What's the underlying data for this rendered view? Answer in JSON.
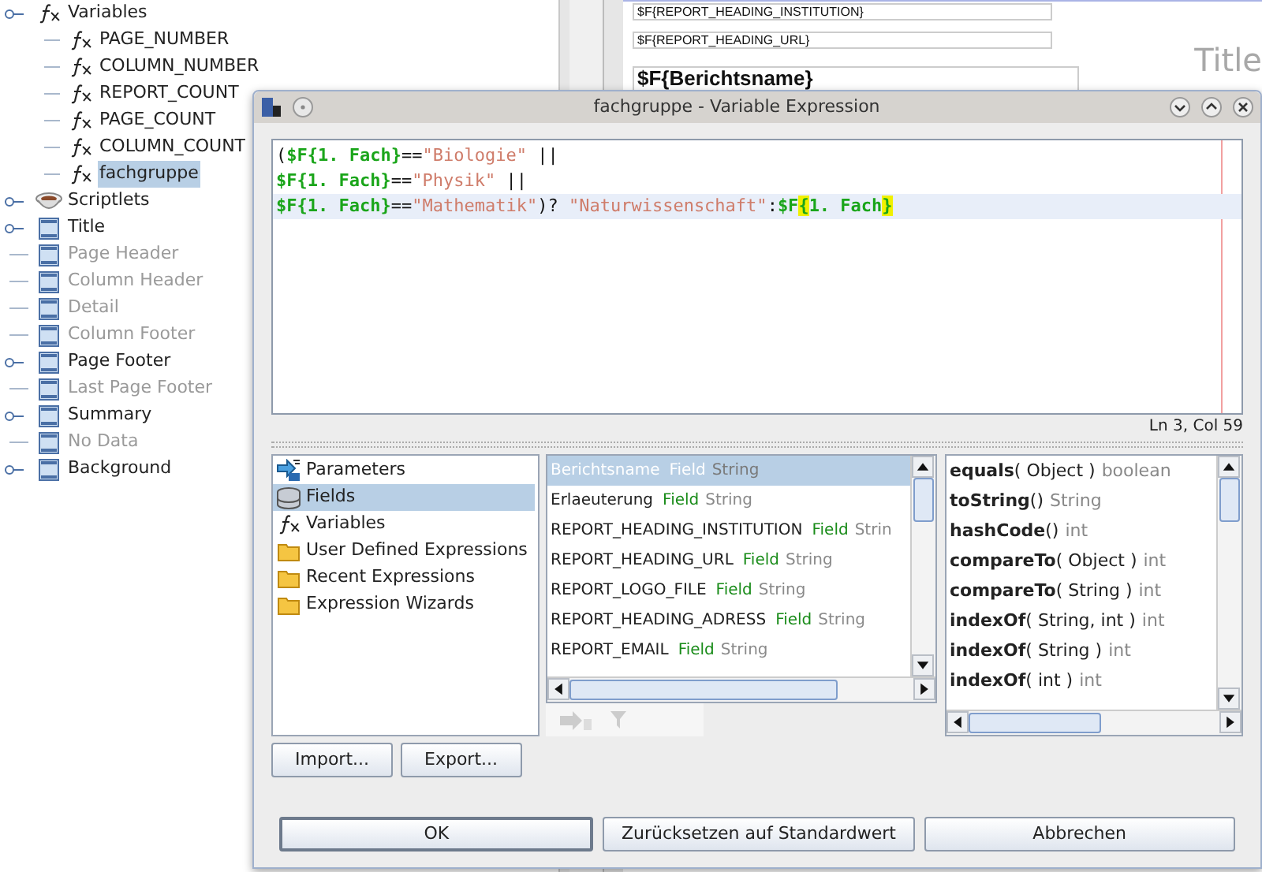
{
  "tree": [
    {
      "label": "Variables",
      "kind": "fx",
      "disabled": false,
      "selected": false,
      "expander": true,
      "children": [
        {
          "label": "PAGE_NUMBER",
          "kind": "fx",
          "disabled": false,
          "selected": false
        },
        {
          "label": "COLUMN_NUMBER",
          "kind": "fx",
          "disabled": false,
          "selected": false
        },
        {
          "label": "REPORT_COUNT",
          "kind": "fx",
          "disabled": false,
          "selected": false
        },
        {
          "label": "PAGE_COUNT",
          "kind": "fx",
          "disabled": false,
          "selected": false
        },
        {
          "label": "COLUMN_COUNT",
          "kind": "fx",
          "disabled": false,
          "selected": false
        },
        {
          "label": "fachgruppe",
          "kind": "fx",
          "disabled": false,
          "selected": true
        }
      ]
    },
    {
      "label": "Scriptlets",
      "kind": "cup",
      "disabled": false,
      "selected": false,
      "expander": true
    },
    {
      "label": "Title",
      "kind": "band",
      "disabled": false,
      "selected": false,
      "expander": true
    },
    {
      "label": "Page Header",
      "kind": "band",
      "disabled": true,
      "selected": false,
      "expander": false
    },
    {
      "label": "Column Header",
      "kind": "band",
      "disabled": true,
      "selected": false,
      "expander": false
    },
    {
      "label": "Detail",
      "kind": "band",
      "disabled": true,
      "selected": false,
      "expander": false
    },
    {
      "label": "Column Footer",
      "kind": "band",
      "disabled": true,
      "selected": false,
      "expander": false
    },
    {
      "label": "Page Footer",
      "kind": "band",
      "disabled": false,
      "selected": false,
      "expander": true
    },
    {
      "label": "Last Page Footer",
      "kind": "band",
      "disabled": true,
      "selected": false,
      "expander": false
    },
    {
      "label": "Summary",
      "kind": "band",
      "disabled": false,
      "selected": false,
      "expander": true
    },
    {
      "label": "No Data",
      "kind": "band",
      "disabled": true,
      "selected": false,
      "expander": false
    },
    {
      "label": "Background",
      "kind": "band",
      "disabled": false,
      "selected": false,
      "expander": true
    }
  ],
  "canvas": {
    "fields": [
      {
        "text": "$F{REPORT_HEADING_INSTITUTION}",
        "kind": "small"
      },
      {
        "text": "$F{REPORT_HEADING_URL}",
        "kind": "small"
      },
      {
        "text": "$F{Berichtsname}",
        "kind": "large"
      }
    ],
    "band_label": "Title"
  },
  "dialog": {
    "title": "fachgruppe - Variable Expression",
    "code": [
      {
        "current": false,
        "tokens": [
          {
            "kind": "plain",
            "text": "("
          },
          {
            "kind": "field",
            "text": "$F{1. Fach}"
          },
          {
            "kind": "plain",
            "text": "=="
          },
          {
            "kind": "string",
            "text": "\"Biologie\""
          },
          {
            "kind": "plain",
            "text": " ||"
          }
        ]
      },
      {
        "current": false,
        "tokens": [
          {
            "kind": "field",
            "text": "$F{1. Fach}"
          },
          {
            "kind": "plain",
            "text": "=="
          },
          {
            "kind": "string",
            "text": "\"Physik\""
          },
          {
            "kind": "plain",
            "text": " ||"
          }
        ]
      },
      {
        "current": true,
        "tokens": [
          {
            "kind": "field",
            "text": "$F{1. Fach}"
          },
          {
            "kind": "plain",
            "text": "=="
          },
          {
            "kind": "string",
            "text": "\"Mathematik\""
          },
          {
            "kind": "plain",
            "text": ")? "
          },
          {
            "kind": "string",
            "text": "\"Naturwissenschaft\""
          },
          {
            "kind": "plain",
            "text": ":"
          },
          {
            "kind": "field",
            "text": "$F"
          },
          {
            "kind": "match",
            "text": "{"
          },
          {
            "kind": "field",
            "text": "1. Fach"
          },
          {
            "kind": "match",
            "text": "}"
          }
        ]
      }
    ],
    "caret_position": "Ln 3, Col 59",
    "categories": [
      {
        "label": "Parameters",
        "kind": "parameters",
        "selected": false
      },
      {
        "label": "Fields",
        "kind": "fields",
        "selected": true
      },
      {
        "label": "Variables",
        "kind": "fx",
        "selected": false
      },
      {
        "label": "User Defined Expressions",
        "kind": "folder",
        "selected": false
      },
      {
        "label": "Recent Expressions",
        "kind": "folder",
        "selected": false
      },
      {
        "label": "Expression Wizards",
        "kind": "folder",
        "selected": false
      }
    ],
    "fields": [
      {
        "name": "Berichtsname",
        "kind_label": "Field",
        "type": "String",
        "selected": true
      },
      {
        "name": "Erlaeuterung",
        "kind_label": "Field",
        "type": "String",
        "selected": false
      },
      {
        "name": "REPORT_HEADING_INSTITUTION",
        "kind_label": "Field",
        "type": "Strin",
        "selected": false
      },
      {
        "name": "REPORT_HEADING_URL",
        "kind_label": "Field",
        "type": "String",
        "selected": false
      },
      {
        "name": "REPORT_LOGO_FILE",
        "kind_label": "Field",
        "type": "String",
        "selected": false
      },
      {
        "name": "REPORT_HEADING_ADRESS",
        "kind_label": "Field",
        "type": "String",
        "selected": false
      },
      {
        "name": "REPORT_EMAIL",
        "kind_label": "Field",
        "type": "String",
        "selected": false
      }
    ],
    "methods": [
      {
        "name": "equals",
        "params": "( Object )",
        "returns": "boolean"
      },
      {
        "name": "toString",
        "params": "()",
        "returns": "String"
      },
      {
        "name": "hashCode",
        "params": "()",
        "returns": "int"
      },
      {
        "name": "compareTo",
        "params": "( Object )",
        "returns": "int"
      },
      {
        "name": "compareTo",
        "params": "( String )",
        "returns": "int"
      },
      {
        "name": "indexOf",
        "params": "( String, int )",
        "returns": "int"
      },
      {
        "name": "indexOf",
        "params": "( String )",
        "returns": "int"
      },
      {
        "name": "indexOf",
        "params": "( int )",
        "returns": "int"
      }
    ],
    "side_buttons": [
      "Import...",
      "Export..."
    ],
    "buttons": [
      {
        "label": "OK",
        "default": true
      },
      {
        "label": "Zurücksetzen auf Standardwert",
        "default": false
      },
      {
        "label": "Abbrechen",
        "default": false
      }
    ]
  }
}
